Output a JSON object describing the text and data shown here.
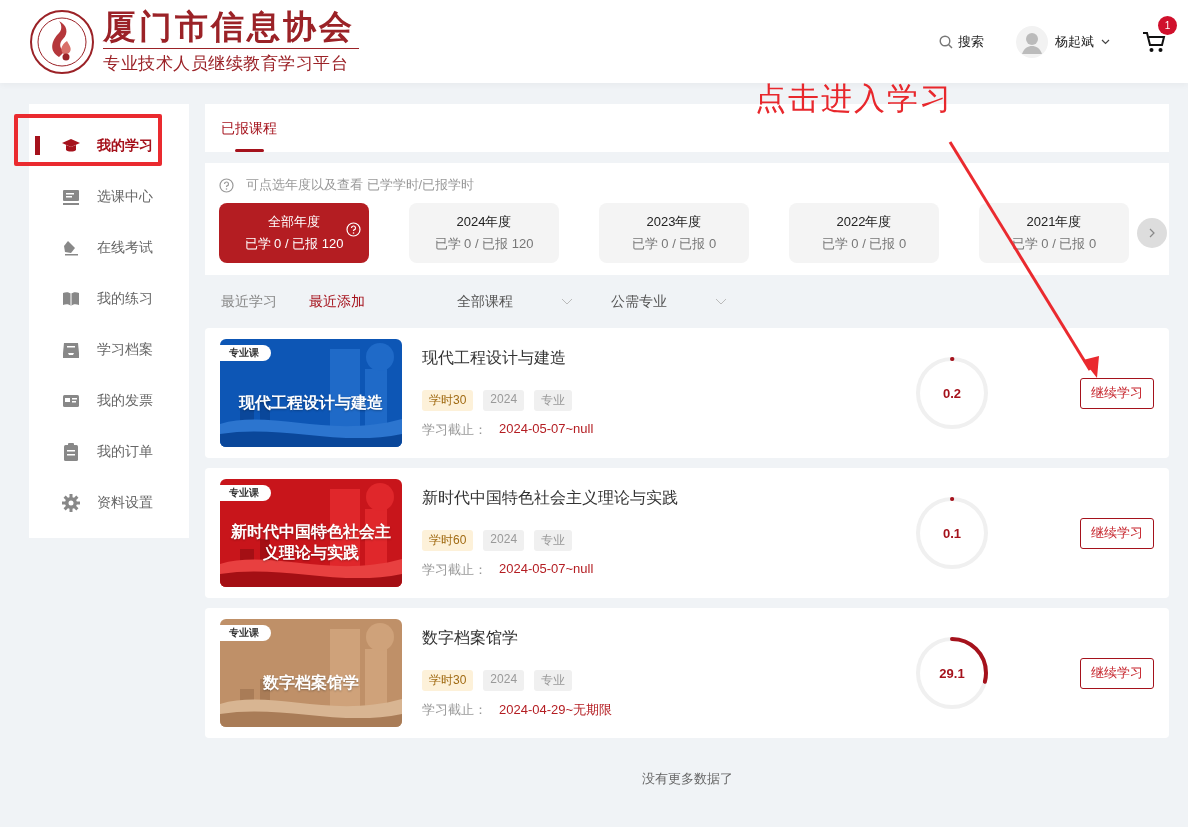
{
  "header": {
    "org_name": "厦门市信息协会",
    "platform_name": "专业技术人员继续教育学习平台",
    "search_label": "搜索",
    "user_name": "杨起斌",
    "cart_count": "1"
  },
  "sidebar": {
    "items": [
      {
        "label": "我的学习",
        "selected": true
      },
      {
        "label": "选课中心",
        "selected": false
      },
      {
        "label": "在线考试",
        "selected": false
      },
      {
        "label": "我的练习",
        "selected": false
      },
      {
        "label": "学习档案",
        "selected": false
      },
      {
        "label": "我的发票",
        "selected": false
      },
      {
        "label": "我的订单",
        "selected": false
      },
      {
        "label": "资料设置",
        "selected": false
      }
    ]
  },
  "tabs": [
    {
      "label": "已报课程",
      "selected": true
    }
  ],
  "year_filter": {
    "hint": "可点选年度以及查看 已学学时/已报学时",
    "years": [
      {
        "label": "全部年度",
        "stats": "已学 0 / 已报 120",
        "selected": true
      },
      {
        "label": "2024年度",
        "stats": "已学 0 / 已报 120",
        "selected": false
      },
      {
        "label": "2023年度",
        "stats": "已学 0 / 已报 0",
        "selected": false
      },
      {
        "label": "2022年度",
        "stats": "已学 0 / 已报 0",
        "selected": false
      },
      {
        "label": "2021年度",
        "stats": "已学 0 / 已报 0",
        "selected": false
      }
    ]
  },
  "sort_tabs": [
    {
      "label": "最近学习",
      "selected": false
    },
    {
      "label": "最近添加",
      "selected": true
    }
  ],
  "dropdowns": [
    "全部课程",
    "公需专业"
  ],
  "courses": [
    {
      "cover_badge": "专业课",
      "cover_title": "现代工程设计与建造",
      "title": "现代工程设计与建造",
      "tags": [
        {
          "text": "学时30",
          "kind": "hours"
        },
        {
          "text": "2024",
          "kind": "plain"
        },
        {
          "text": "专业",
          "kind": "plain"
        }
      ],
      "deadline_label": "学习截止：",
      "deadline": "2024-05-07~null",
      "progress": {
        "level": 0.002,
        "reading": "0.2"
      },
      "button": "继续学习"
    },
    {
      "cover_badge": "专业课",
      "cover_title": "新时代中国特色社会主义理论与实践",
      "title": "新时代中国特色社会主义理论与实践",
      "tags": [
        {
          "text": "学时60",
          "kind": "hours"
        },
        {
          "text": "2024",
          "kind": "plain"
        },
        {
          "text": "专业",
          "kind": "plain"
        }
      ],
      "deadline_label": "学习截止：",
      "deadline": "2024-05-07~null",
      "progress": {
        "level": 0.001,
        "reading": "0.1"
      },
      "button": "继续学习"
    },
    {
      "cover_badge": "专业课",
      "cover_title": "数字档案馆学",
      "title": "数字档案馆学",
      "tags": [
        {
          "text": "学时30",
          "kind": "hours"
        },
        {
          "text": "2024",
          "kind": "plain"
        },
        {
          "text": "专业",
          "kind": "plain"
        }
      ],
      "deadline_label": "学习截止：",
      "deadline": "2024-04-29~无期限",
      "progress": {
        "level": 0.291,
        "reading": "29.1"
      },
      "button": "继续学习"
    }
  ],
  "footer_note": "没有更多数据了",
  "annotation": {
    "callout_text": "点击进入学习"
  }
}
